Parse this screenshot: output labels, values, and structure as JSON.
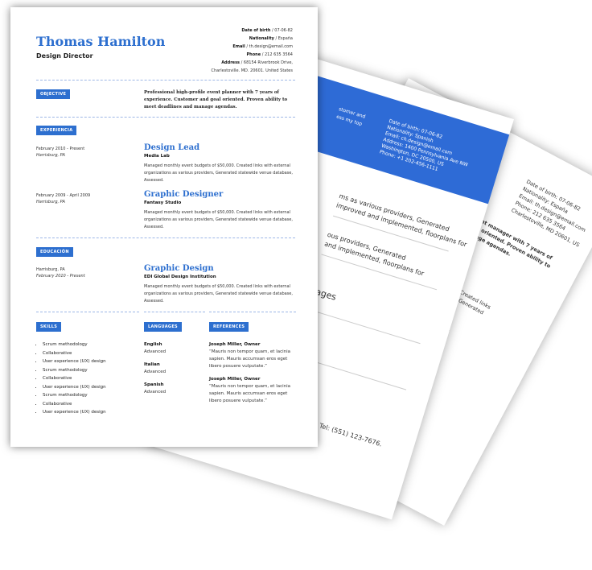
{
  "resume": {
    "name": "Thomas Hamilton",
    "title": "Design Director",
    "contact": [
      {
        "label": "Date of birth",
        "value": "07-06-82"
      },
      {
        "label": "Nationality",
        "value": "España"
      },
      {
        "label": "Email",
        "value": "th.design@email.com"
      },
      {
        "label": "Phone",
        "value": "212 635 3564"
      },
      {
        "label": "Address",
        "value": "68154 Riverbrook Drive,"
      },
      {
        "label": "",
        "value": "Charlestoville. MD. 20601. United States"
      }
    ],
    "objective_label": "OBJECTIVE",
    "objective_text": "Professional high-profile event planner with 7 years of experience. Customer and goal oriented. Proven ability to meet deadlines and manage agendas.",
    "experience_label": "EXPERIENCIA",
    "experience": [
      {
        "date": "February 2010 - Present",
        "place": "Harrisburg, PA",
        "role": "Design Lead",
        "company": "Media Lab",
        "desc": "Managed monthly event budgets of $50,000. Created links with external organizations as various providers, Generated statewide venue database, Assessed."
      },
      {
        "date": "February 2009 - April 2009",
        "place": "Harrisburg, PA",
        "role": "Graphic Designer",
        "company": "Fantasy Studio",
        "desc": "Managed monthly event budgets of $50,000. Created links with external organizations as various providers, Generated statewide venue database, Assessed."
      }
    ],
    "education_label": "EDUCACIÓN",
    "education": [
      {
        "place": "Harrisburg, PA",
        "date": "February 2010 - Present",
        "role": "Graphic Design",
        "company": "EDI Global Design Institution",
        "desc": "Managed monthly event budgets of $50,000. Created links with external organizations as various providers, Generated statewide venue database, Assessed."
      }
    ],
    "skills_label": "SKILLS",
    "skills": [
      "Scrum methodology",
      "Collaborative",
      "User experience (UX) design",
      "Scrum methodology",
      "Collaborative",
      "User experience (UX) design",
      "Scrum methodology",
      "Collaborative",
      "User experience (UX) design"
    ],
    "languages_label": "LANGUAGES",
    "languages": [
      {
        "name": "English",
        "level": "Advanced"
      },
      {
        "name": "Italian",
        "level": "Advanced"
      },
      {
        "name": "Spanish",
        "level": "Advanced"
      }
    ],
    "references_label": "REFERENCES",
    "references": [
      {
        "name": "Joseph Miller, Owner",
        "text": "“Mauris non tempor quam, et lacinia sapien. Mauris accumsan eros eget libero posuere vulputate.”"
      },
      {
        "name": "Joseph Miller, Owner",
        "text": "“Mauris non tempor quam, et lacinia sapien. Mauris accumsan eros eget libero posuere vulputate.”"
      }
    ]
  },
  "back_sheet_1": {
    "band": [
      "Date of birth: 07-06-82",
      "Nationality: Spanish",
      "Email: ch.design@email.com",
      "Address: 1400 Pennsylvania Ave NW",
      "Washington, DC 20500, US",
      "Phone: +1 202-456-1111"
    ],
    "band_left": [
      "stomer and",
      "ess my top"
    ],
    "lines": [
      "ms as various providers, Generated",
      "improved and implemented, floorplans for",
      "ous providers, Generated",
      "and implemented, floorplans for",
      "uages",
      "San Francisco. Tel: (551) 123-7676.",
      "r Manager"
    ]
  },
  "back_sheet_2": {
    "lines": [
      "Date of birth: 07-06-82",
      "Nationality: España",
      "Email: th.design@email.com",
      "Phone: 212 635 3564",
      "Charlestoville, MD 20601, US",
      "event manager with 7 years of",
      "Goal oriented. Proven ability to",
      "manage agendas.",
      "$50,000. Created links",
      "providers, Generated",
      "Created links",
      "Generated"
    ]
  }
}
